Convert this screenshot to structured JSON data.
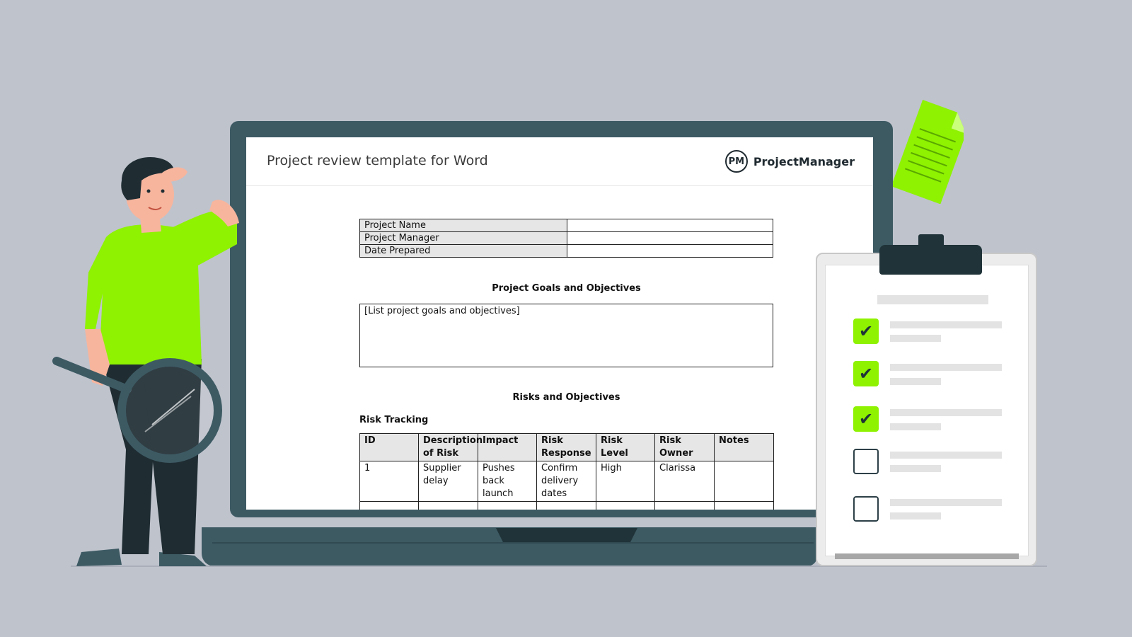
{
  "document": {
    "title": "Project review template for Word",
    "brand": {
      "logo_text": "PM",
      "name": "ProjectManager"
    },
    "info_rows": [
      {
        "label": "Project Name",
        "value": ""
      },
      {
        "label": "Project Manager",
        "value": ""
      },
      {
        "label": "Date Prepared",
        "value": ""
      }
    ],
    "goals": {
      "heading": "Project Goals and Objectives",
      "placeholder": "[List project goals and objectives]"
    },
    "risks": {
      "heading": "Risks and Objectives",
      "subheading": "Risk Tracking",
      "columns": [
        "ID",
        "Description of Risk",
        "Impact",
        "Risk Response",
        "Risk Level",
        "Risk Owner",
        "Notes"
      ],
      "rows": [
        [
          "1",
          "Supplier delay",
          "Pushes back launch",
          "Confirm delivery dates",
          "High",
          "Clarissa",
          ""
        ]
      ]
    }
  },
  "checklist": {
    "items": [
      {
        "checked": true
      },
      {
        "checked": true
      },
      {
        "checked": true
      },
      {
        "checked": false
      },
      {
        "checked": false
      }
    ],
    "check_glyph": "✔"
  },
  "colors": {
    "background": "#bfc3cc",
    "laptop": "#3d5a63",
    "accent_green": "#8ef200",
    "dark": "#1f3338"
  }
}
